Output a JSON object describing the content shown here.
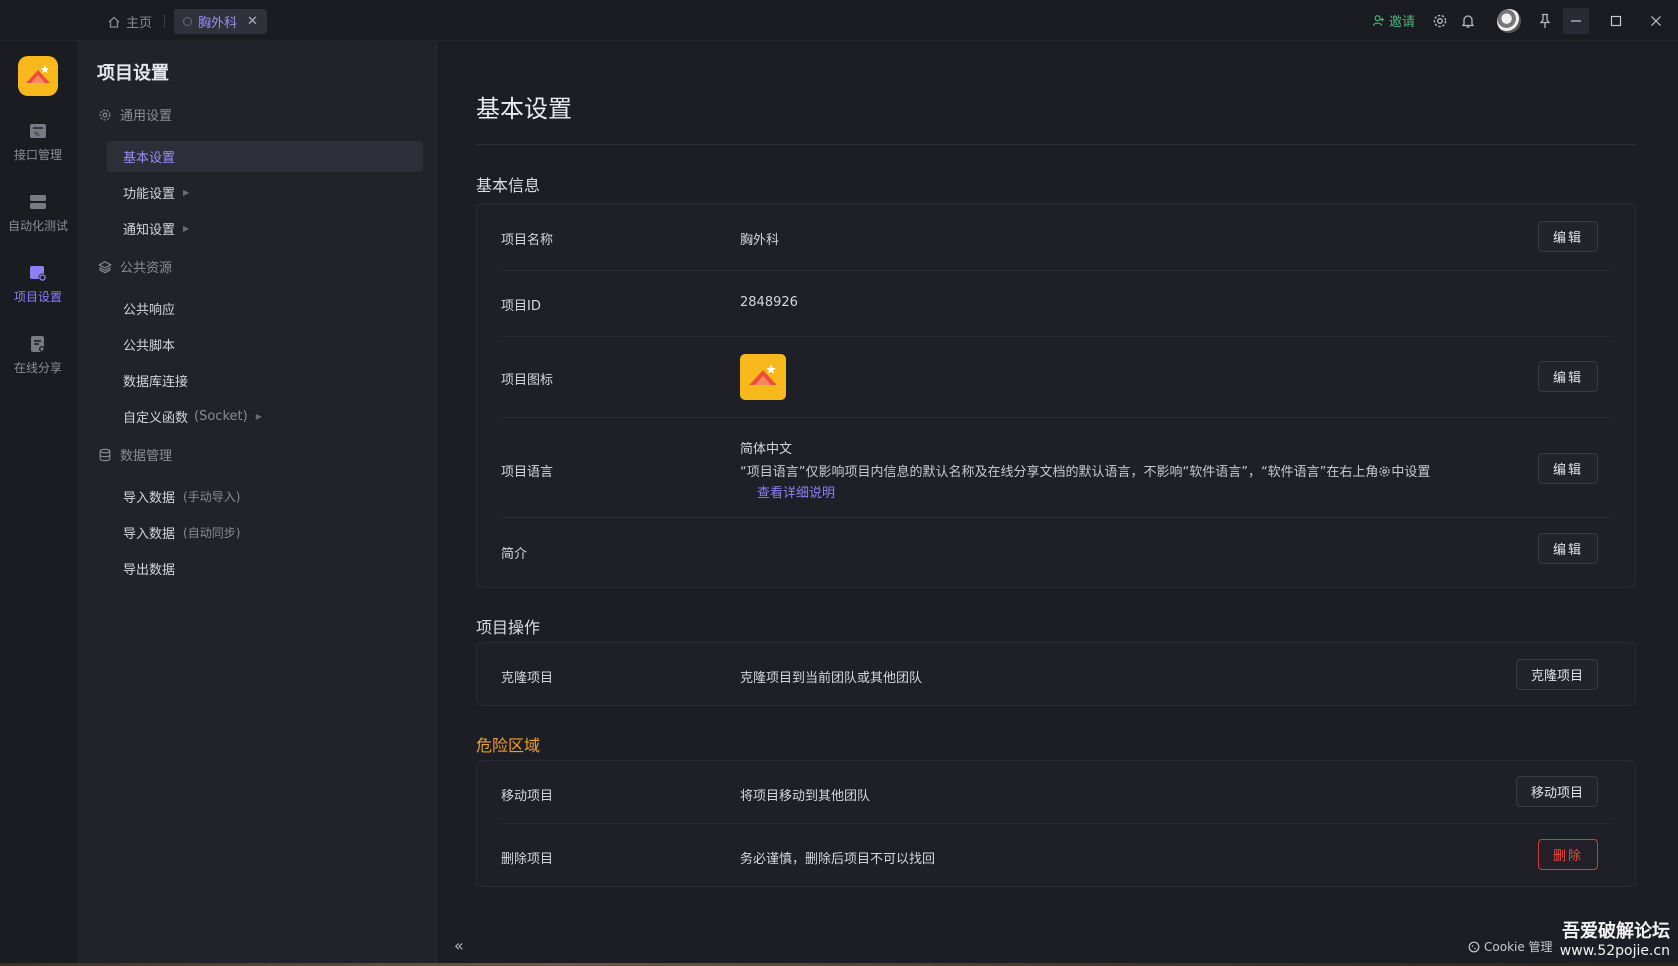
{
  "titlebar": {
    "home_tab": "主页",
    "active_tab": "胸外科",
    "invite": "邀请"
  },
  "rail": [
    {
      "label": "接口管理",
      "icon": "api-icon"
    },
    {
      "label": "自动化测试",
      "icon": "automation-icon"
    },
    {
      "label": "项目设置",
      "icon": "project-settings-icon",
      "active": true
    },
    {
      "label": "在线分享",
      "icon": "share-icon"
    }
  ],
  "nav": {
    "title": "项目设置",
    "general": {
      "label": "通用设置",
      "items": [
        "基本设置",
        "功能设置",
        "通知设置"
      ]
    },
    "public": {
      "label": "公共资源",
      "items": [
        "公共响应",
        "公共脚本",
        "数据库连接",
        "自定义函数"
      ],
      "socket": "(Socket)"
    },
    "data": {
      "label": "数据管理",
      "items": [
        "导入数据",
        "导入数据",
        "导出数据"
      ],
      "hints": [
        "(手动导入)",
        "(自动同步)"
      ]
    }
  },
  "main": {
    "title": "基本设置",
    "basic_info": {
      "title": "基本信息",
      "name_label": "项目名称",
      "name_value": "胸外科",
      "id_label": "项目ID",
      "id_value": "2848926",
      "icon_label": "项目图标",
      "lang_label": "项目语言",
      "lang_value": "简体中文",
      "lang_note_a": "“项目语言”仅影响项目内信息的默认名称及在线分享文档的默认语言，不影响“软件语言”，“软件语言”在右上角",
      "lang_note_b": "中设置",
      "lang_link": "查看详细说明",
      "intro_label": "简介",
      "edit": "编辑"
    },
    "operations": {
      "title": "项目操作",
      "clone_label": "克隆项目",
      "clone_desc": "克隆项目到当前团队或其他团队",
      "clone_button": "克隆项目"
    },
    "danger": {
      "title": "危险区域",
      "move_label": "移动项目",
      "move_desc": "将项目移动到其他团队",
      "move_button": "移动项目",
      "delete_label": "删除项目",
      "delete_desc": "务必谨慎，删除后项目不可以找回",
      "delete_button": "删除"
    }
  },
  "footer": {
    "cookie": "Cookie 管理",
    "watermark_1": "吾爱破解论坛",
    "watermark_2": "www.52pojie.cn"
  },
  "colors": {
    "accent": "#8f7ff3",
    "danger": "#ee4646",
    "warning": "#f0a030",
    "invite": "#49b47c",
    "logo": "#f6b81a"
  }
}
